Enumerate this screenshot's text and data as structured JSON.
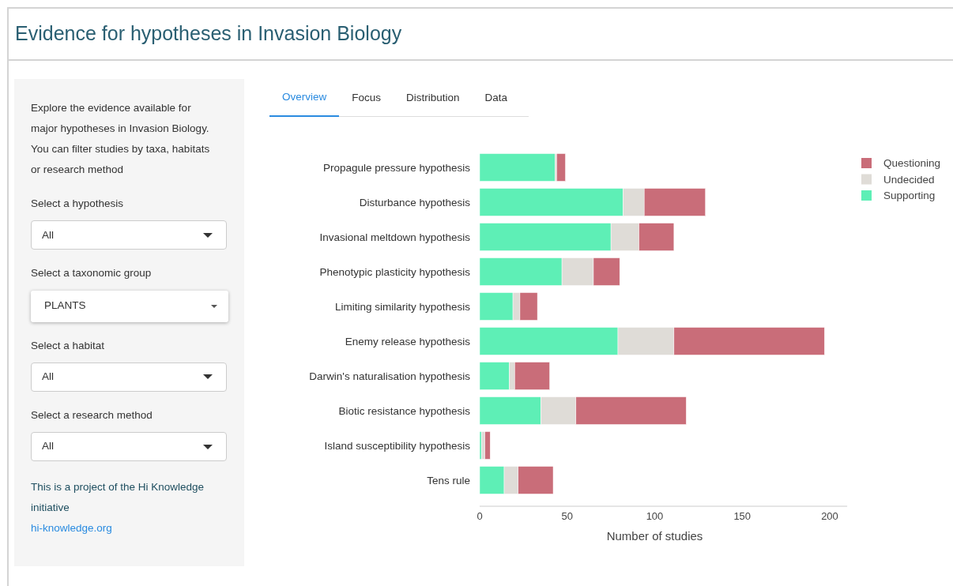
{
  "header": {
    "title": "Evidence for hypotheses in Invasion Biology"
  },
  "sidebar": {
    "intro": "Explore the evidence available for major hypotheses in Invasion Biology. You can filter studies by taxa, habitats or research method",
    "selects": [
      {
        "label": "Select a hypothesis",
        "value": "All",
        "focused": false
      },
      {
        "label": "Select a taxonomic group",
        "value": "PLANTS",
        "focused": true
      },
      {
        "label": "Select a habitat",
        "value": "All",
        "focused": false
      },
      {
        "label": "Select a research method",
        "value": "All",
        "focused": false
      }
    ],
    "footer": "This is a project of the Hi Knowledge initiative",
    "link": "hi-knowledge.org"
  },
  "tabs": [
    {
      "label": "Overview",
      "selected": true
    },
    {
      "label": "Focus",
      "selected": false
    },
    {
      "label": "Distribution",
      "selected": false
    },
    {
      "label": "Data",
      "selected": false
    }
  ],
  "chart_data": {
    "type": "bar",
    "orientation": "horizontal",
    "stacked": true,
    "xlabel": "Number of studies",
    "categories": [
      "Propagule pressure hypothesis",
      "Disturbance hypothesis",
      "Invasional meltdown hypothesis",
      "Phenotypic plasticity hypothesis",
      "Limiting similarity hypothesis",
      "Enemy release hypothesis",
      "Darwin's naturalisation hypothesis",
      "Biotic resistance hypothesis",
      "Island susceptibility hypothesis",
      "Tens rule"
    ],
    "series": [
      {
        "name": "Supporting",
        "color": "#5eefb6",
        "values": [
          43,
          82,
          75,
          47,
          19,
          79,
          17,
          35,
          1,
          14
        ]
      },
      {
        "name": "Undecided",
        "color": "#dfdcd7",
        "values": [
          1,
          12,
          16,
          18,
          4,
          32,
          3,
          20,
          2,
          8
        ]
      },
      {
        "name": "Questioning",
        "color": "#c96d79",
        "values": [
          5,
          35,
          20,
          15,
          10,
          86,
          20,
          63,
          3,
          20
        ]
      }
    ],
    "xlim": [
      0,
      210
    ],
    "xticks": [
      0,
      50,
      100,
      150,
      200
    ],
    "legend": true
  }
}
